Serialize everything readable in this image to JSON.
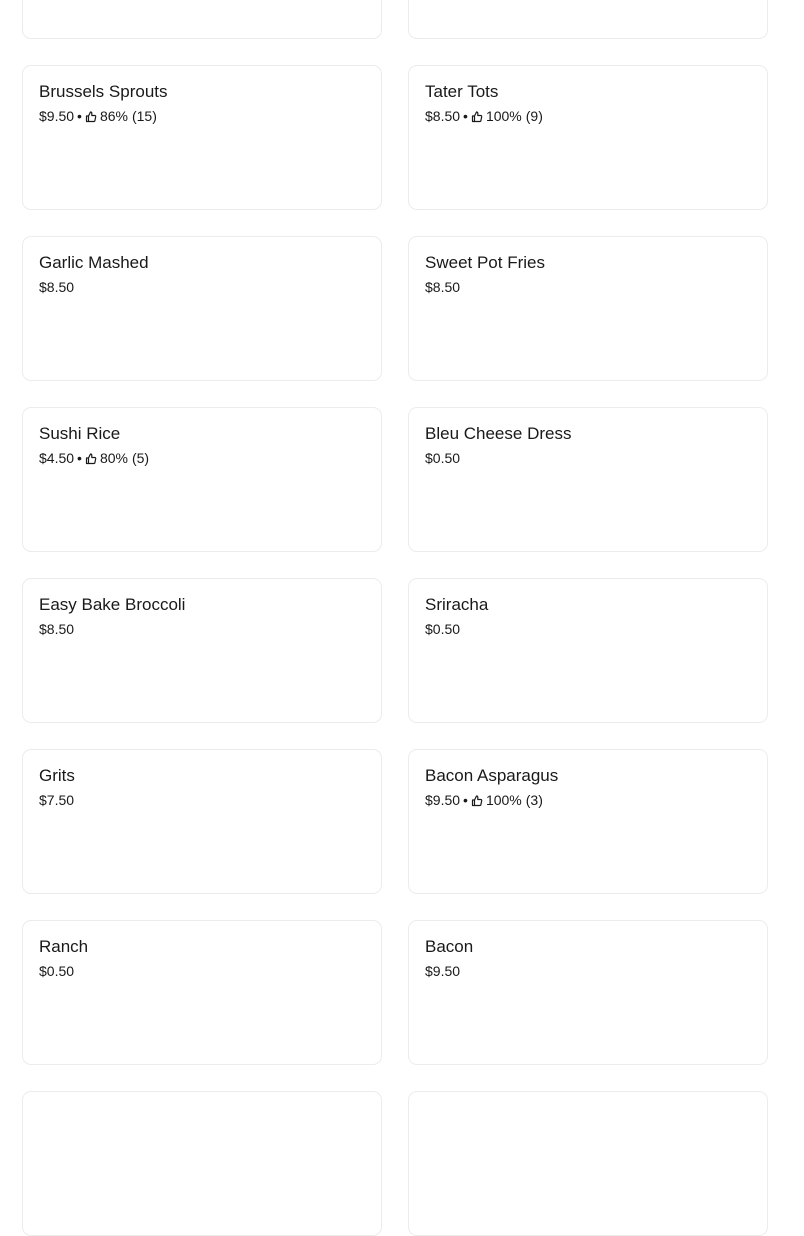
{
  "items": [
    {
      "name": "",
      "price": "",
      "rating": "",
      "count": ""
    },
    {
      "name": "",
      "price": "",
      "rating": "",
      "count": ""
    },
    {
      "name": "Brussels Sprouts",
      "price": "$9.50",
      "rating": "86%",
      "count": "(15)"
    },
    {
      "name": "Tater Tots",
      "price": "$8.50",
      "rating": "100%",
      "count": "(9)"
    },
    {
      "name": "Garlic Mashed",
      "price": "$8.50",
      "rating": "",
      "count": ""
    },
    {
      "name": "Sweet Pot Fries",
      "price": "$8.50",
      "rating": "",
      "count": ""
    },
    {
      "name": "Sushi Rice",
      "price": "$4.50",
      "rating": "80%",
      "count": "(5)"
    },
    {
      "name": "Bleu Cheese Dress",
      "price": "$0.50",
      "rating": "",
      "count": ""
    },
    {
      "name": "Easy Bake Broccoli",
      "price": "$8.50",
      "rating": "",
      "count": ""
    },
    {
      "name": "Sriracha",
      "price": "$0.50",
      "rating": "",
      "count": ""
    },
    {
      "name": "Grits",
      "price": "$7.50",
      "rating": "",
      "count": ""
    },
    {
      "name": "Bacon Asparagus",
      "price": "$9.50",
      "rating": "100%",
      "count": "(3)"
    },
    {
      "name": "Ranch",
      "price": "$0.50",
      "rating": "",
      "count": ""
    },
    {
      "name": "Bacon",
      "price": "$9.50",
      "rating": "",
      "count": ""
    },
    {
      "name": "",
      "price": "",
      "rating": "",
      "count": ""
    },
    {
      "name": "",
      "price": "",
      "rating": "",
      "count": ""
    }
  ],
  "separator": "•",
  "icons": {
    "rating": "thumbs-up-icon"
  }
}
